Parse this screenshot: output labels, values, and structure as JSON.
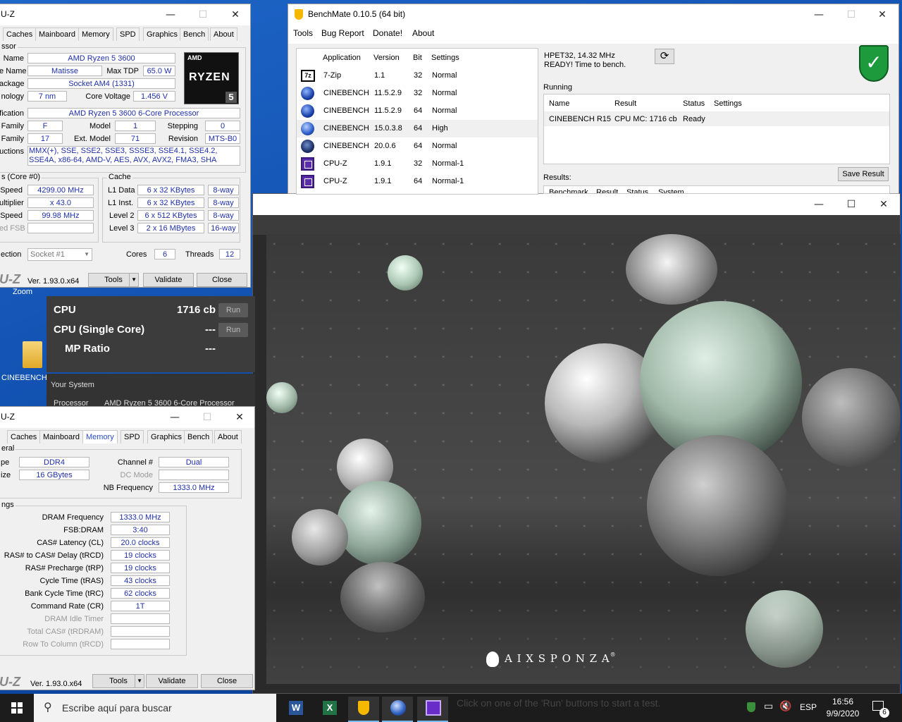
{
  "desktop": {
    "icons": [
      {
        "label": "Zoom"
      },
      {
        "label": "CINEBENCH"
      }
    ]
  },
  "cpuz_top": {
    "title": "U-Z",
    "tabs": [
      "Caches",
      "Mainboard",
      "Memory",
      "SPD",
      "Graphics",
      "Bench",
      "About"
    ],
    "processor_caption": "ssor",
    "name_label": "Name",
    "name": "AMD Ryzen 5 3600",
    "codename_label": "e Name",
    "codename": "Matisse",
    "maxtdp_label": "Max TDP",
    "maxtdp": "65.0 W",
    "package_label": "ackage",
    "package": "Socket AM4 (1331)",
    "tech_label": "nology",
    "tech": "7 nm",
    "corevolt_label": "Core Voltage",
    "corevolt": "1.456 V",
    "spec_label": "fication",
    "spec": "AMD Ryzen 5 3600 6-Core Processor",
    "family_label": "Family",
    "family": "F",
    "model_label": "Model",
    "model": "1",
    "stepping_label": "Stepping",
    "stepping": "0",
    "extfamily_label": "Family",
    "extfamily": "17",
    "extmodel_label": "Ext. Model",
    "extmodel": "71",
    "revision_label": "Revision",
    "revision": "MTS-B0",
    "instr_label": "uctions",
    "instr": "MMX(+), SSE, SSE2, SSE3, SSSE3, SSE4.1, SSE4.2, SSE4A, x86-64, AMD-V, AES, AVX, AVX2, FMA3, SHA",
    "clocks_caption": "s (Core #0)",
    "corespeed_label": "Speed",
    "corespeed": "4299.00 MHz",
    "mult_label": "ultiplier",
    "mult": "x 43.0",
    "bus_label": "Speed",
    "bus": "99.98 MHz",
    "fsb_label": "ed FSB",
    "cache_caption": "Cache",
    "l1d_label": "L1 Data",
    "l1d": "6 x 32 KBytes",
    "l1d_way": "8-way",
    "l1i_label": "L1 Inst.",
    "l1i": "6 x 32 KBytes",
    "l1i_way": "8-way",
    "l2_label": "Level 2",
    "l2": "6 x 512 KBytes",
    "l2_way": "8-way",
    "l3_label": "Level 3",
    "l3": "2 x 16 MBytes",
    "l3_way": "16-way",
    "selection_label": "ection",
    "selection": "Socket #1",
    "cores_label": "Cores",
    "cores": "6",
    "threads_label": "Threads",
    "threads": "12",
    "logo_brand": "AMD",
    "logo_ryzen": "RYZEN",
    "logo_tier": "5",
    "version_logo": "U-Z",
    "version": "Ver. 1.93.0.x64",
    "tools": "Tools",
    "validate": "Validate",
    "close": "Close"
  },
  "cpuz_mem": {
    "title": "U-Z",
    "tabs": [
      "Caches",
      "Mainboard",
      "Memory",
      "SPD",
      "Graphics",
      "Bench",
      "About"
    ],
    "general_caption": "eral",
    "type_label": "pe",
    "type": "DDR4",
    "size_label": "ize",
    "size": "16 GBytes",
    "channel_label": "Channel #",
    "channel": "Dual",
    "dcmode_label": "DC Mode",
    "nbfreq_label": "NB Frequency",
    "nbfreq": "1333.0 MHz",
    "timings_caption": "ngs",
    "timings": [
      {
        "label": "DRAM Frequency",
        "value": "1333.0 MHz"
      },
      {
        "label": "FSB:DRAM",
        "value": "3:40"
      },
      {
        "label": "CAS# Latency (CL)",
        "value": "20.0 clocks"
      },
      {
        "label": "RAS# to CAS# Delay (tRCD)",
        "value": "19 clocks"
      },
      {
        "label": "RAS# Precharge (tRP)",
        "value": "19 clocks"
      },
      {
        "label": "Cycle Time (tRAS)",
        "value": "43 clocks"
      },
      {
        "label": "Bank Cycle Time (tRC)",
        "value": "62 clocks"
      },
      {
        "label": "Command Rate (CR)",
        "value": "1T"
      },
      {
        "label": "DRAM Idle Timer",
        "value": ""
      },
      {
        "label": "Total CAS# (tRDRAM)",
        "value": ""
      },
      {
        "label": "Row To Column (tRCD)",
        "value": ""
      }
    ],
    "version_logo": "U-Z",
    "version": "Ver. 1.93.0.x64",
    "tools": "Tools",
    "validate": "Validate",
    "close": "Close"
  },
  "benchmate": {
    "title": "BenchMate 0.10.5 (64 bit)",
    "menu": [
      "Tools",
      "Bug Report",
      "Donate!",
      "About"
    ],
    "list_headers": [
      "Application",
      "Version",
      "Bit",
      "Settings"
    ],
    "apps": [
      {
        "icon": "7zip-icon",
        "name": "7-Zip",
        "version": "1.1",
        "bit": "32",
        "settings": "Normal"
      },
      {
        "icon": "cinebench-icon",
        "name": "CINEBENCH",
        "version": "11.5.2.9",
        "bit": "32",
        "settings": "Normal"
      },
      {
        "icon": "cinebench-icon",
        "name": "CINEBENCH",
        "version": "11.5.2.9",
        "bit": "64",
        "settings": "Normal"
      },
      {
        "icon": "cinebench-icon",
        "name": "CINEBENCH",
        "version": "15.0.3.8",
        "bit": "64",
        "settings": "High"
      },
      {
        "icon": "cinebench-icon",
        "name": "CINEBENCH",
        "version": "20.0.6",
        "bit": "64",
        "settings": "Normal"
      },
      {
        "icon": "cpuz-icon",
        "name": "CPU-Z",
        "version": "1.9.1",
        "bit": "32",
        "settings": "Normal-1"
      },
      {
        "icon": "cpuz-icon",
        "name": "CPU-Z",
        "version": "1.9.1",
        "bit": "64",
        "settings": "Normal-1"
      }
    ],
    "timer": "HPET32, 14.32 MHz",
    "status": "READY! Time to bench.",
    "running_caption": "Running",
    "running_headers": [
      "Name",
      "Result",
      "Status",
      "Settings"
    ],
    "running_row": {
      "name": "CINEBENCH R15",
      "result": "CPU MC: 1716 cb",
      "status": "Ready",
      "settings": ""
    },
    "results_caption": "Results:",
    "results_headers": [
      "Benchmark",
      "Result",
      "Status",
      "System"
    ],
    "save_result": "Save Result"
  },
  "cinebench": {
    "cpu_label": "CPU",
    "cpu_score": "1716 cb",
    "single_label": "CPU (Single Core)",
    "single_score": "---",
    "mp_label": "MP Ratio",
    "mp_score": "---",
    "run": "Run",
    "your_system": "Your System",
    "processor_label": "Processor",
    "processor": "AMD Ryzen 5 3600 6-Core Processor",
    "status_hint": "Click on one of the 'Run' buttons to start a test.",
    "render_brand": "A I X S P O N Z A",
    "render_brand_mark": "®",
    "colors": {
      "panel": "#3c3c3c",
      "accent": "#ffffff"
    }
  },
  "taskbar": {
    "search_placeholder": "Escribe aquí para buscar",
    "lang": "ESP",
    "time": "16:56",
    "date": "9/9/2020",
    "notifications": "6"
  }
}
